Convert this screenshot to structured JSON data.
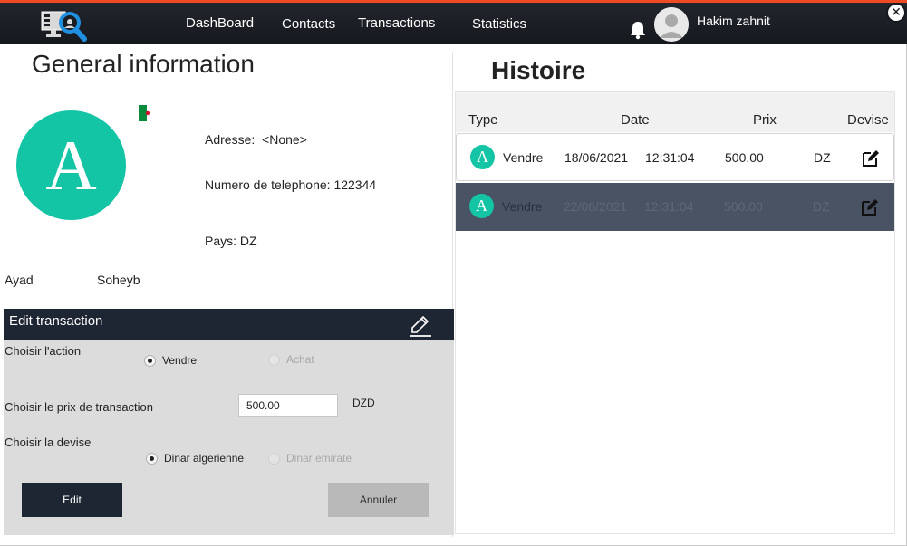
{
  "navbar": {
    "links": [
      {
        "label": "DashBoard"
      },
      {
        "label": "Contacts"
      },
      {
        "label": "Transactions"
      },
      {
        "label": "Statistics"
      }
    ],
    "user_name": "Hakim zahnit",
    "close_glyph": "✕",
    "icons": [
      "app-logo-icon",
      "bell-icon",
      "user-avatar-icon",
      "close-icon"
    ]
  },
  "general_info": {
    "title": "General information",
    "avatar_letter": "A",
    "address_label": "Adresse:",
    "address_value": "<None>",
    "phone_label": "Numero de telephone:",
    "phone_value": "122344",
    "country_label": "Pays:",
    "country_value": "DZ",
    "last_name": "Ayad",
    "first_name": "Soheyb"
  },
  "edit_transaction": {
    "title": "Edit transaction",
    "action_label": "Choisir  l'action",
    "action_options": [
      {
        "label": "Vendre",
        "selected": true,
        "enabled": true
      },
      {
        "label": "Achat",
        "selected": false,
        "enabled": false
      }
    ],
    "price_label": "Choisir le prix de transaction",
    "price_value": "500.00",
    "price_unit": "DZD",
    "currency_label": "Choisir la devise",
    "currency_options": [
      {
        "label": "Dinar algerienne",
        "selected": true,
        "enabled": true
      },
      {
        "label": "Dinar emirate",
        "selected": false,
        "enabled": false
      }
    ],
    "edit_button": "Edit",
    "cancel_button": "Annuler"
  },
  "history": {
    "title": "Histoire",
    "columns": [
      "Type",
      "Date",
      "Prix",
      "Devise"
    ],
    "rows": [
      {
        "avatar": "A",
        "type": "Vendre",
        "date": "18/06/2021",
        "time": "12:31:04",
        "price": "500.00",
        "currency": "DZ",
        "selected": false
      },
      {
        "avatar": "A",
        "type": "Vendre",
        "date": "22/06/2021",
        "time": "12:31:04",
        "price": "500.00",
        "currency": "DZ",
        "selected": true
      }
    ]
  },
  "colors": {
    "accent": "#f04a24",
    "navbar": "#1a1d22",
    "avatar": "#13c4a5",
    "panel_header": "#1f2633",
    "selected_row": "#4a5364"
  }
}
